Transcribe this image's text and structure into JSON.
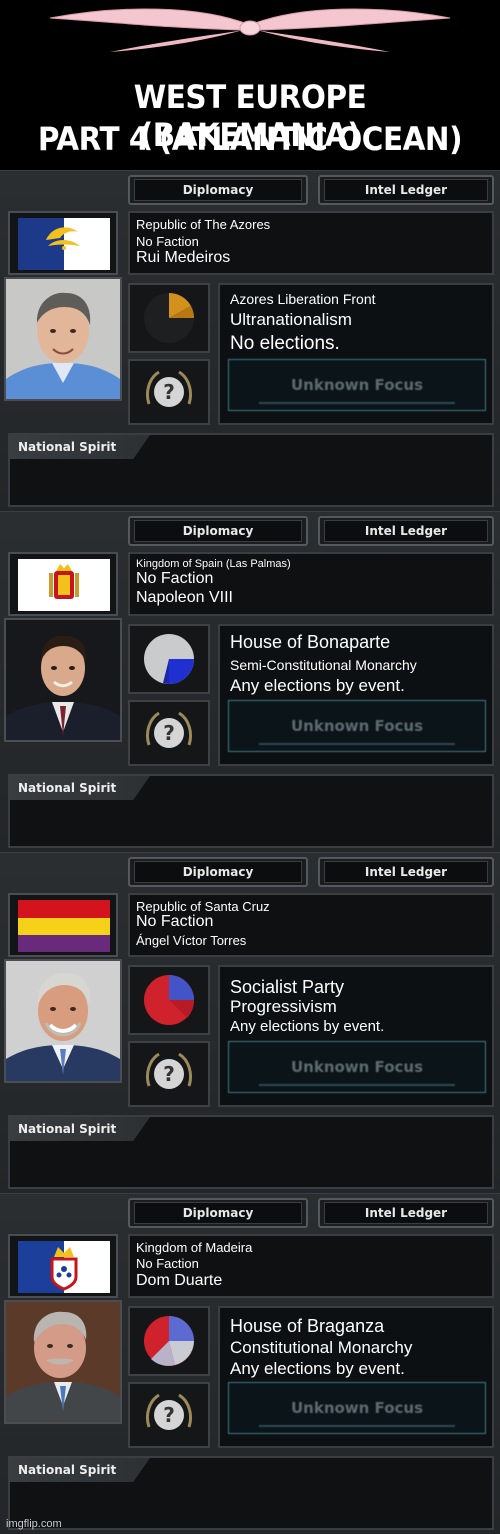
{
  "header": {
    "title_line1": "WEST EUROPE (BAKEMANIA)",
    "title_line2": "PART 4 (ATLANTIC OCEAN)"
  },
  "tabs": {
    "diplomacy": "Diplomacy",
    "intel": "Intel Ledger"
  },
  "spirit_label": "National Spirit",
  "focus_label": "Unknown Focus",
  "countries": [
    {
      "name": "Republic of The Azores",
      "faction": "No Faction",
      "leader": "Rui Medeiros",
      "party": "Azores Liberation Front",
      "ideology": "Ultranationalism",
      "elections": "No elections."
    },
    {
      "name": "Kingdom of Spain (Las Palmas)",
      "faction": "No Faction",
      "leader": "Napoleon VIII",
      "party": "House of Bonaparte",
      "ideology": "Semi-Constitutional Monarchy",
      "elections": "Any elections by event."
    },
    {
      "name": "Republic of Santa Cruz",
      "faction": "No Faction",
      "leader": "Ángel Víctor Torres",
      "party": "Socialist Party",
      "ideology": "Progressivism",
      "elections": "Any elections by event."
    },
    {
      "name": "Kingdom of Madeira",
      "faction": "No Faction",
      "leader": "Dom Duarte",
      "party": "House of Braganza",
      "ideology": "Constitutional Monarchy",
      "elections": "Any elections by event."
    }
  ],
  "watermark": "imgflip.com",
  "colors": {
    "panel_bg": "#2b2e31",
    "focus_border": "#3f7d86"
  }
}
